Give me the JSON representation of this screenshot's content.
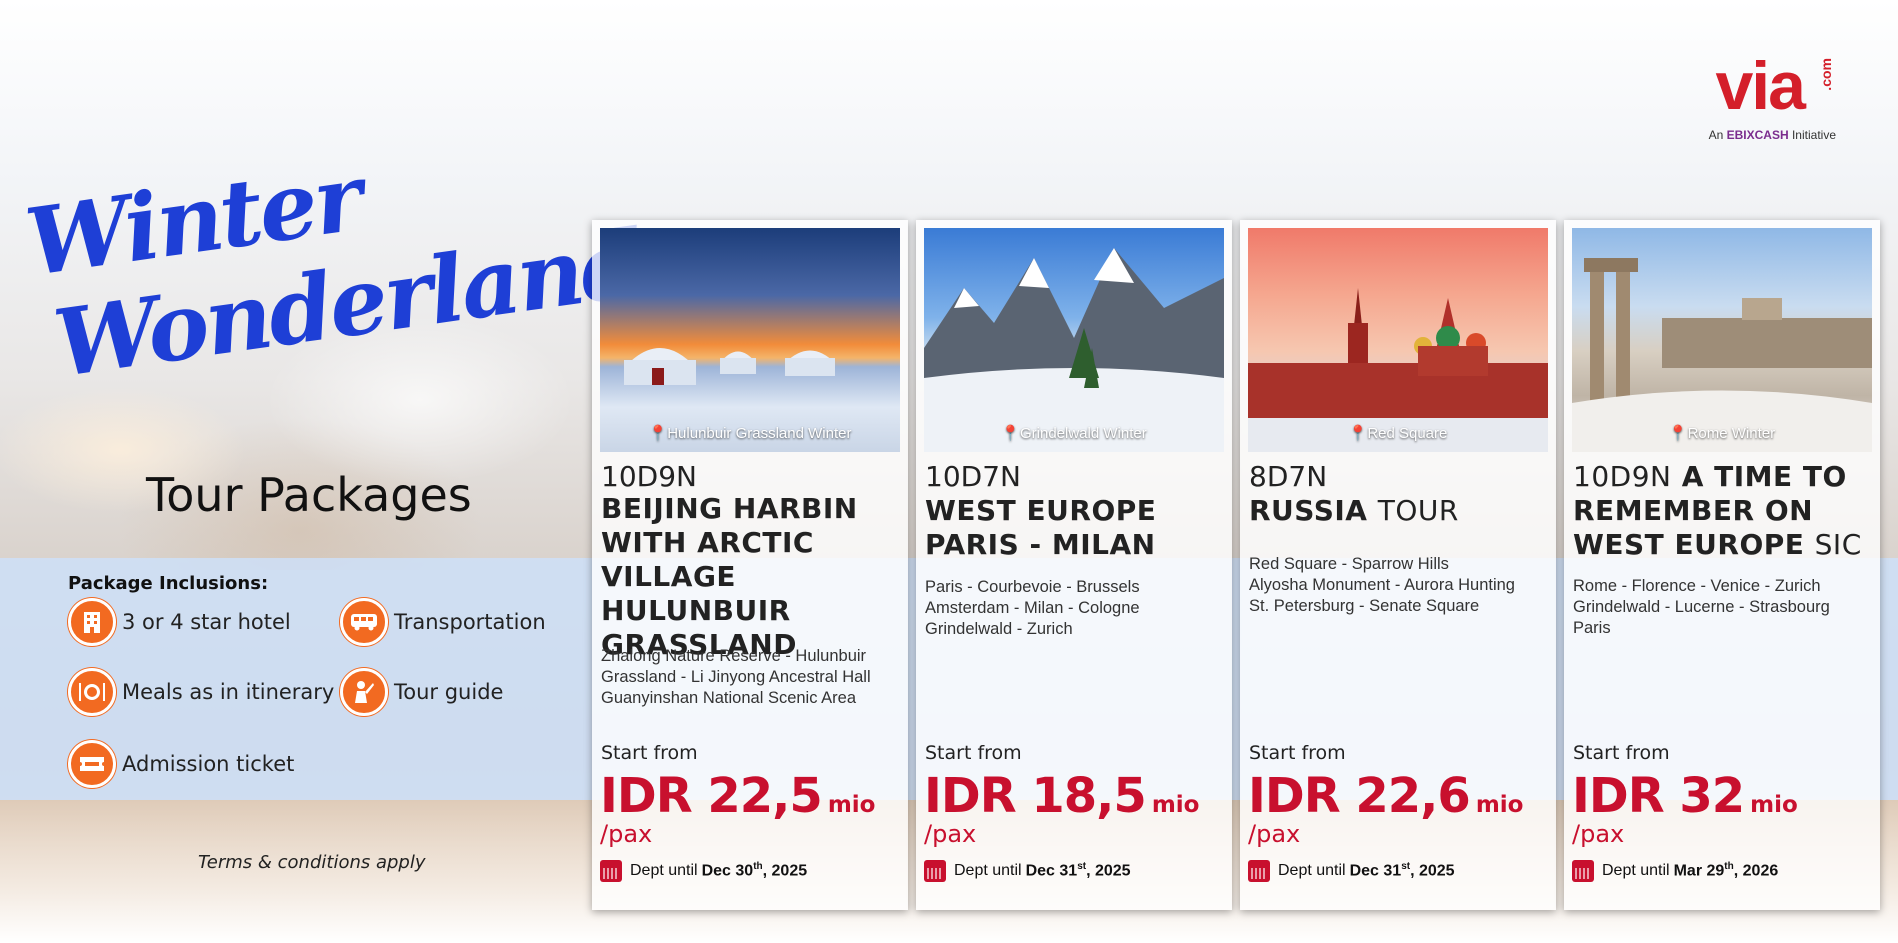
{
  "brand": {
    "name": "via",
    "suffix": ".com",
    "tagline_prefix": "An",
    "tagline_brand": "EBIXCASH",
    "tagline_suffix": "Initiative"
  },
  "hero": {
    "title_line1": "Winter",
    "title_line2": "Wonderland",
    "subtitle": "Tour Packages"
  },
  "inclusions": {
    "title": "Package Inclusions:",
    "items": [
      {
        "label": "3 or 4 star hotel",
        "icon": "hotel-icon"
      },
      {
        "label": "Transportation",
        "icon": "bus-icon"
      },
      {
        "label": "Meals as in itinerary",
        "icon": "meal-icon"
      },
      {
        "label": "Tour guide",
        "icon": "tour-guide-icon"
      },
      {
        "label": "Admission ticket",
        "icon": "ticket-icon"
      }
    ]
  },
  "terms": "Terms & conditions apply",
  "packages": [
    {
      "location": "Hulunbuir Grassland Winter",
      "code": "10D9N",
      "name_bold": "BEIJING HARBIN WITH ARCTIC VILLAGE HULUNBUIR GRASSLAND",
      "name_normal": "",
      "route": [
        "Zhalong Nature Reserve - Hulunbuir",
        "Grassland - Li Jinyong Ancestral Hall",
        "Guanyinshan National Scenic Area"
      ],
      "start_label": "Start from",
      "price": "IDR 22,5",
      "unit": "mio",
      "per": "/pax",
      "dept_prefix": "Dept until",
      "dept_date": "Dec 30",
      "dept_ord": "th",
      "dept_year": ", 2025"
    },
    {
      "location": "Grindelwald Winter",
      "code": "10D7N",
      "name_bold": "WEST EUROPE PARIS - MILAN",
      "name_normal": "",
      "route": [
        "Paris - Courbevoie - Brussels",
        "Amsterdam - Milan - Cologne",
        "Grindelwald - Zurich"
      ],
      "start_label": "Start from",
      "price": "IDR 18,5",
      "unit": "mio",
      "per": "/pax",
      "dept_prefix": "Dept until",
      "dept_date": "Dec 31",
      "dept_ord": "st",
      "dept_year": ", 2025"
    },
    {
      "location": "Red Square",
      "code": "8D7N",
      "name_bold": "RUSSIA",
      "name_normal": "TOUR",
      "route": [
        "Red Square - Sparrow Hills",
        "Alyosha Monument - Aurora Hunting",
        "St. Petersburg - Senate Square"
      ],
      "start_label": "Start from",
      "price": "IDR 22,6",
      "unit": "mio",
      "per": "/pax",
      "dept_prefix": "Dept until",
      "dept_date": "Dec 31",
      "dept_ord": "st",
      "dept_year": ", 2025"
    },
    {
      "location": "Rome Winter",
      "code": "10D9N",
      "name_bold": "A TIME TO REMEMBER ON WEST EUROPE",
      "name_normal": "SIC",
      "route": [
        "Rome - Florence - Venice - Zurich",
        "Grindelwald - Lucerne - Strasbourg",
        "Paris"
      ],
      "start_label": "Start from",
      "price": "IDR 32",
      "unit": "mio",
      "per": "/pax",
      "dept_prefix": "Dept until",
      "dept_date": "Mar 29",
      "dept_ord": "th",
      "dept_year": ", 2026"
    }
  ],
  "colors": {
    "accent_red": "#c8102e",
    "title_blue": "#1e3fd6",
    "icon_orange": "#f26a21"
  }
}
